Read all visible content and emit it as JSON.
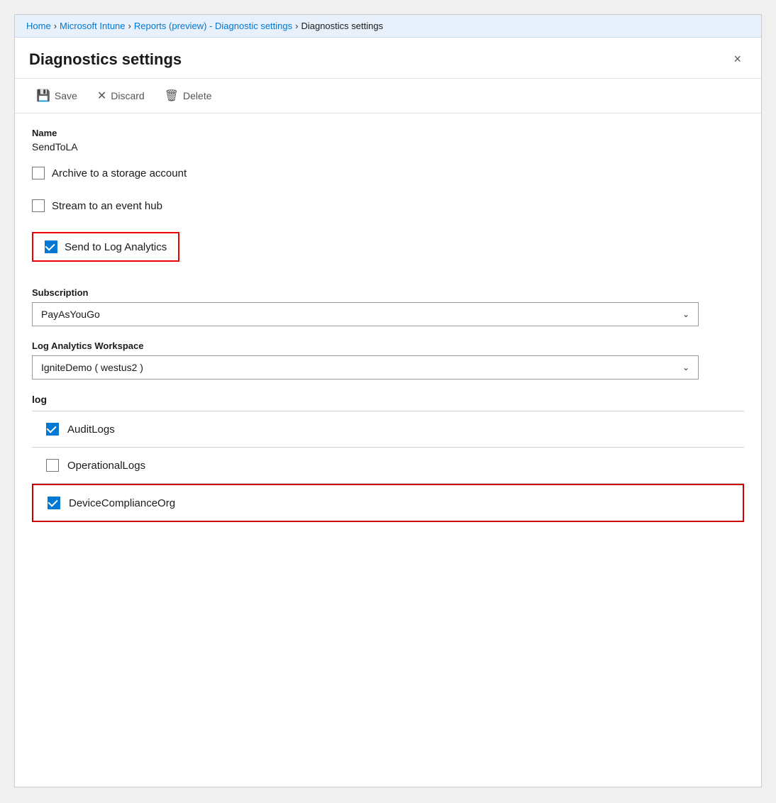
{
  "breadcrumb": {
    "items": [
      {
        "label": "Home",
        "link": true
      },
      {
        "label": "Microsoft Intune",
        "link": true
      },
      {
        "label": "Reports (preview) - Diagnostic settings",
        "link": true
      },
      {
        "label": "Diagnostics settings",
        "link": false
      }
    ]
  },
  "header": {
    "title": "Diagnostics settings",
    "close_label": "×"
  },
  "toolbar": {
    "save_label": "Save",
    "discard_label": "Discard",
    "delete_label": "Delete"
  },
  "form": {
    "name_label": "Name",
    "name_value": "SendToLA",
    "archive_label": "Archive to a storage account",
    "archive_checked": false,
    "stream_label": "Stream to an event hub",
    "stream_checked": false,
    "send_log_analytics_label": "Send to Log Analytics",
    "send_log_analytics_checked": true,
    "subscription_label": "Subscription",
    "subscription_value": "PayAsYouGo",
    "workspace_label": "Log Analytics Workspace",
    "workspace_value": "IgniteDemo ( westus2 )",
    "log_section_title": "log",
    "log_items": [
      {
        "label": "AuditLogs",
        "checked": true,
        "highlighted": false
      },
      {
        "label": "OperationalLogs",
        "checked": false,
        "highlighted": false
      },
      {
        "label": "DeviceComplianceOrg",
        "checked": true,
        "highlighted": true
      }
    ]
  },
  "icons": {
    "save": "💾",
    "discard": "✕",
    "delete": "🗑",
    "chevron_down": "∨",
    "close": "✕"
  }
}
